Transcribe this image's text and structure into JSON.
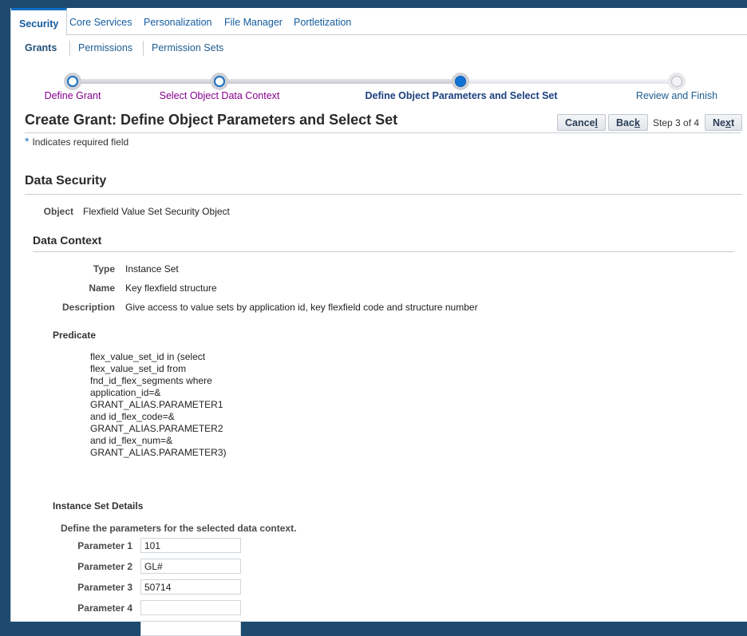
{
  "tabs": [
    {
      "label": "Security",
      "active": true
    },
    {
      "label": "Core Services",
      "active": false
    },
    {
      "label": "Personalization",
      "active": false
    },
    {
      "label": "File Manager",
      "active": false
    },
    {
      "label": "Portletization",
      "active": false
    }
  ],
  "subtabs": [
    {
      "label": "Grants",
      "active": true
    },
    {
      "label": "Permissions",
      "active": false
    },
    {
      "label": "Permission Sets",
      "active": false
    }
  ],
  "train": {
    "current_step": 3,
    "total_steps": 4,
    "steps": [
      {
        "label": "Define Grant",
        "state": "visited"
      },
      {
        "label": "Select Object Data Context",
        "state": "visited"
      },
      {
        "label": "Define Object Parameters and Select Set",
        "state": "current"
      },
      {
        "label": "Review and Finish",
        "state": "future"
      }
    ]
  },
  "header": {
    "title": "Create Grant: Define Object Parameters and Select Set",
    "cancel_pre": "Cance",
    "cancel_key": "l",
    "cancel_post": "",
    "back_pre": "Bac",
    "back_key": "k",
    "back_post": "",
    "step_text": "Step 3 of 4",
    "next_pre": "Ne",
    "next_key": "x",
    "next_post": "t",
    "required_star": "*",
    "required_text": "Indicates required field"
  },
  "data_security": {
    "heading": "Data Security",
    "object_label": "Object",
    "object_value": "Flexfield Value Set Security Object"
  },
  "data_context": {
    "heading": "Data Context",
    "type_label": "Type",
    "type_value": "Instance Set",
    "name_label": "Name",
    "name_value": "Key flexfield structure",
    "description_label": "Description",
    "description_value": "Give access to value sets by application id, key flexfield code and structure number",
    "predicate_label": "Predicate",
    "predicate_lines": [
      "flex_value_set_id in (select",
      "flex_value_set_id from",
      "fnd_id_flex_segments where",
      "application_id=&",
      "GRANT_ALIAS.PARAMETER1",
      "and id_flex_code=&",
      "GRANT_ALIAS.PARAMETER2",
      "and id_flex_num=&",
      "GRANT_ALIAS.PARAMETER3)"
    ]
  },
  "instance_set_details": {
    "heading": "Instance Set Details",
    "hint": "Define the parameters for the selected data context.",
    "parameters": [
      {
        "label": "Parameter 1",
        "value": "101"
      },
      {
        "label": "Parameter 2",
        "value": "GL#"
      },
      {
        "label": "Parameter 3",
        "value": "50714"
      },
      {
        "label": "Parameter 4",
        "value": ""
      },
      {
        "label": "",
        "value": ""
      }
    ]
  }
}
